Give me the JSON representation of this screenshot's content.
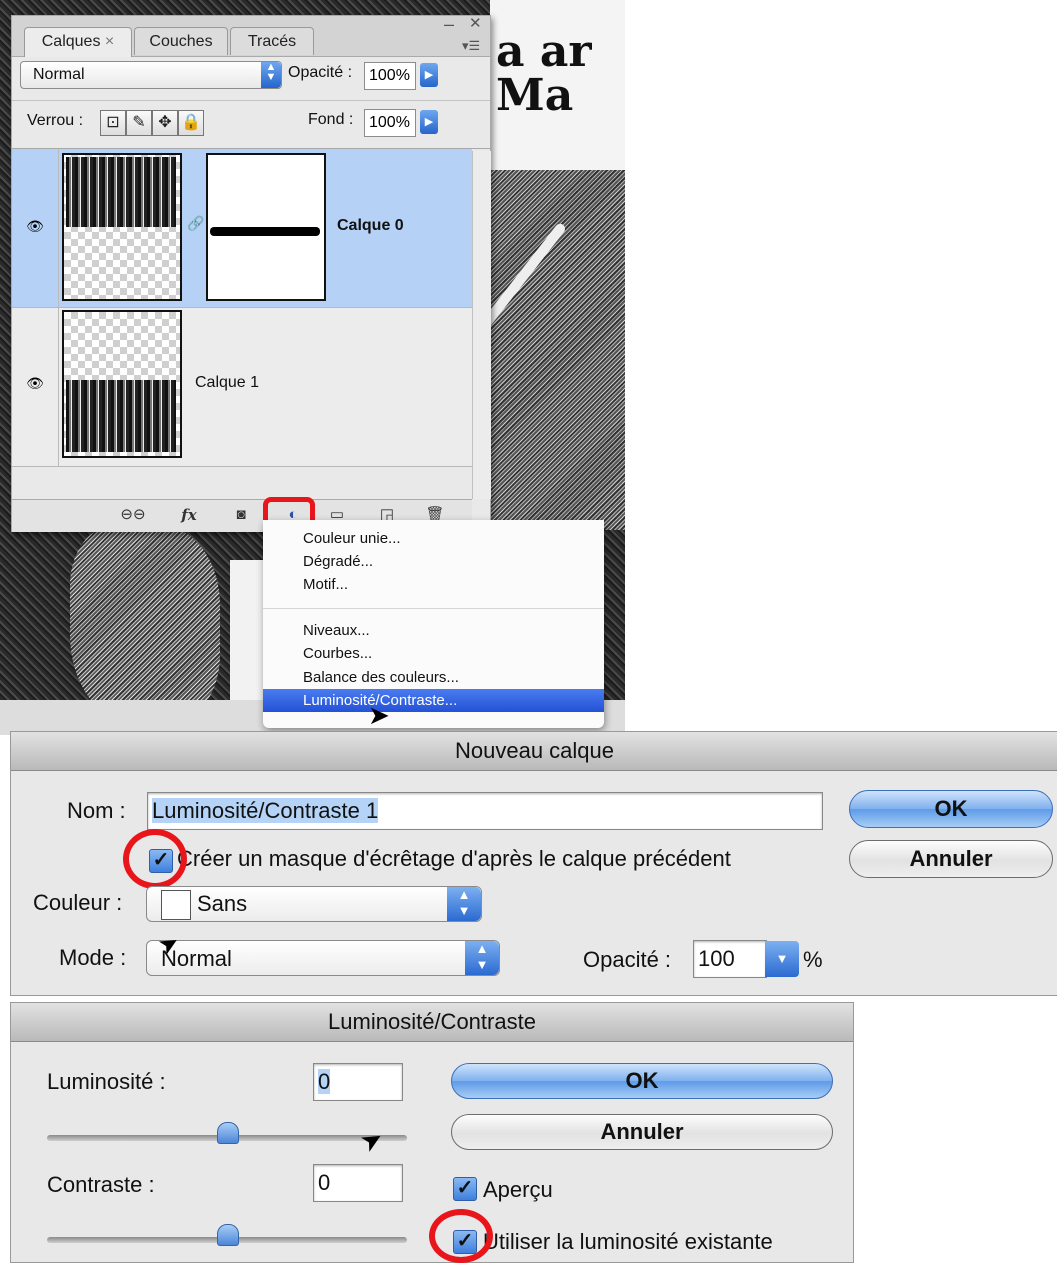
{
  "layers_panel": {
    "tabs": [
      "Calques",
      "Couches",
      "Tracés"
    ],
    "tab_close": "×",
    "blend_mode": "Normal",
    "opacity_label": "Opacité :",
    "opacity_value": "100%",
    "lock_label": "Verrou :",
    "fill_label": "Fond :",
    "fill_value": "100%",
    "layers": [
      {
        "name": "Calque 0",
        "selected": true,
        "visible": true
      },
      {
        "name": "Calque 1",
        "selected": false,
        "visible": true
      }
    ],
    "footer_icons": [
      "link-icon",
      "fx-icon",
      "mask-icon",
      "adjustment-layer-icon",
      "folder-icon",
      "new-layer-icon",
      "trash-icon"
    ],
    "fx_label": "fx"
  },
  "adjust_menu": {
    "group1": [
      "Couleur unie...",
      "Dégradé...",
      "Motif..."
    ],
    "group2": [
      "Niveaux...",
      "Courbes...",
      "Balance des couleurs...",
      "Luminosité/Contraste..."
    ],
    "selected": "Luminosité/Contraste..."
  },
  "new_layer_dialog": {
    "title": "Nouveau calque",
    "name_label": "Nom :",
    "name_value": "Luminosité/Contraste 1",
    "clip_label": "Créer un masque d'écrêtage d'après le calque précédent",
    "color_label": "Couleur :",
    "color_value": "Sans",
    "mode_label": "Mode :",
    "mode_value": "Normal",
    "opacity_label": "Opacité :",
    "opacity_value": "100",
    "percent": "%",
    "ok_label": "OK",
    "cancel_label": "Annuler"
  },
  "brightness_dialog": {
    "title": "Luminosité/Contraste",
    "brightness_label": "Luminosité :",
    "brightness_value": "0",
    "contrast_label": "Contraste :",
    "contrast_value": "0",
    "ok_label": "OK",
    "cancel_label": "Annuler",
    "preview_label": "Aperçu",
    "legacy_label": "Utiliser la luminosité existante"
  }
}
